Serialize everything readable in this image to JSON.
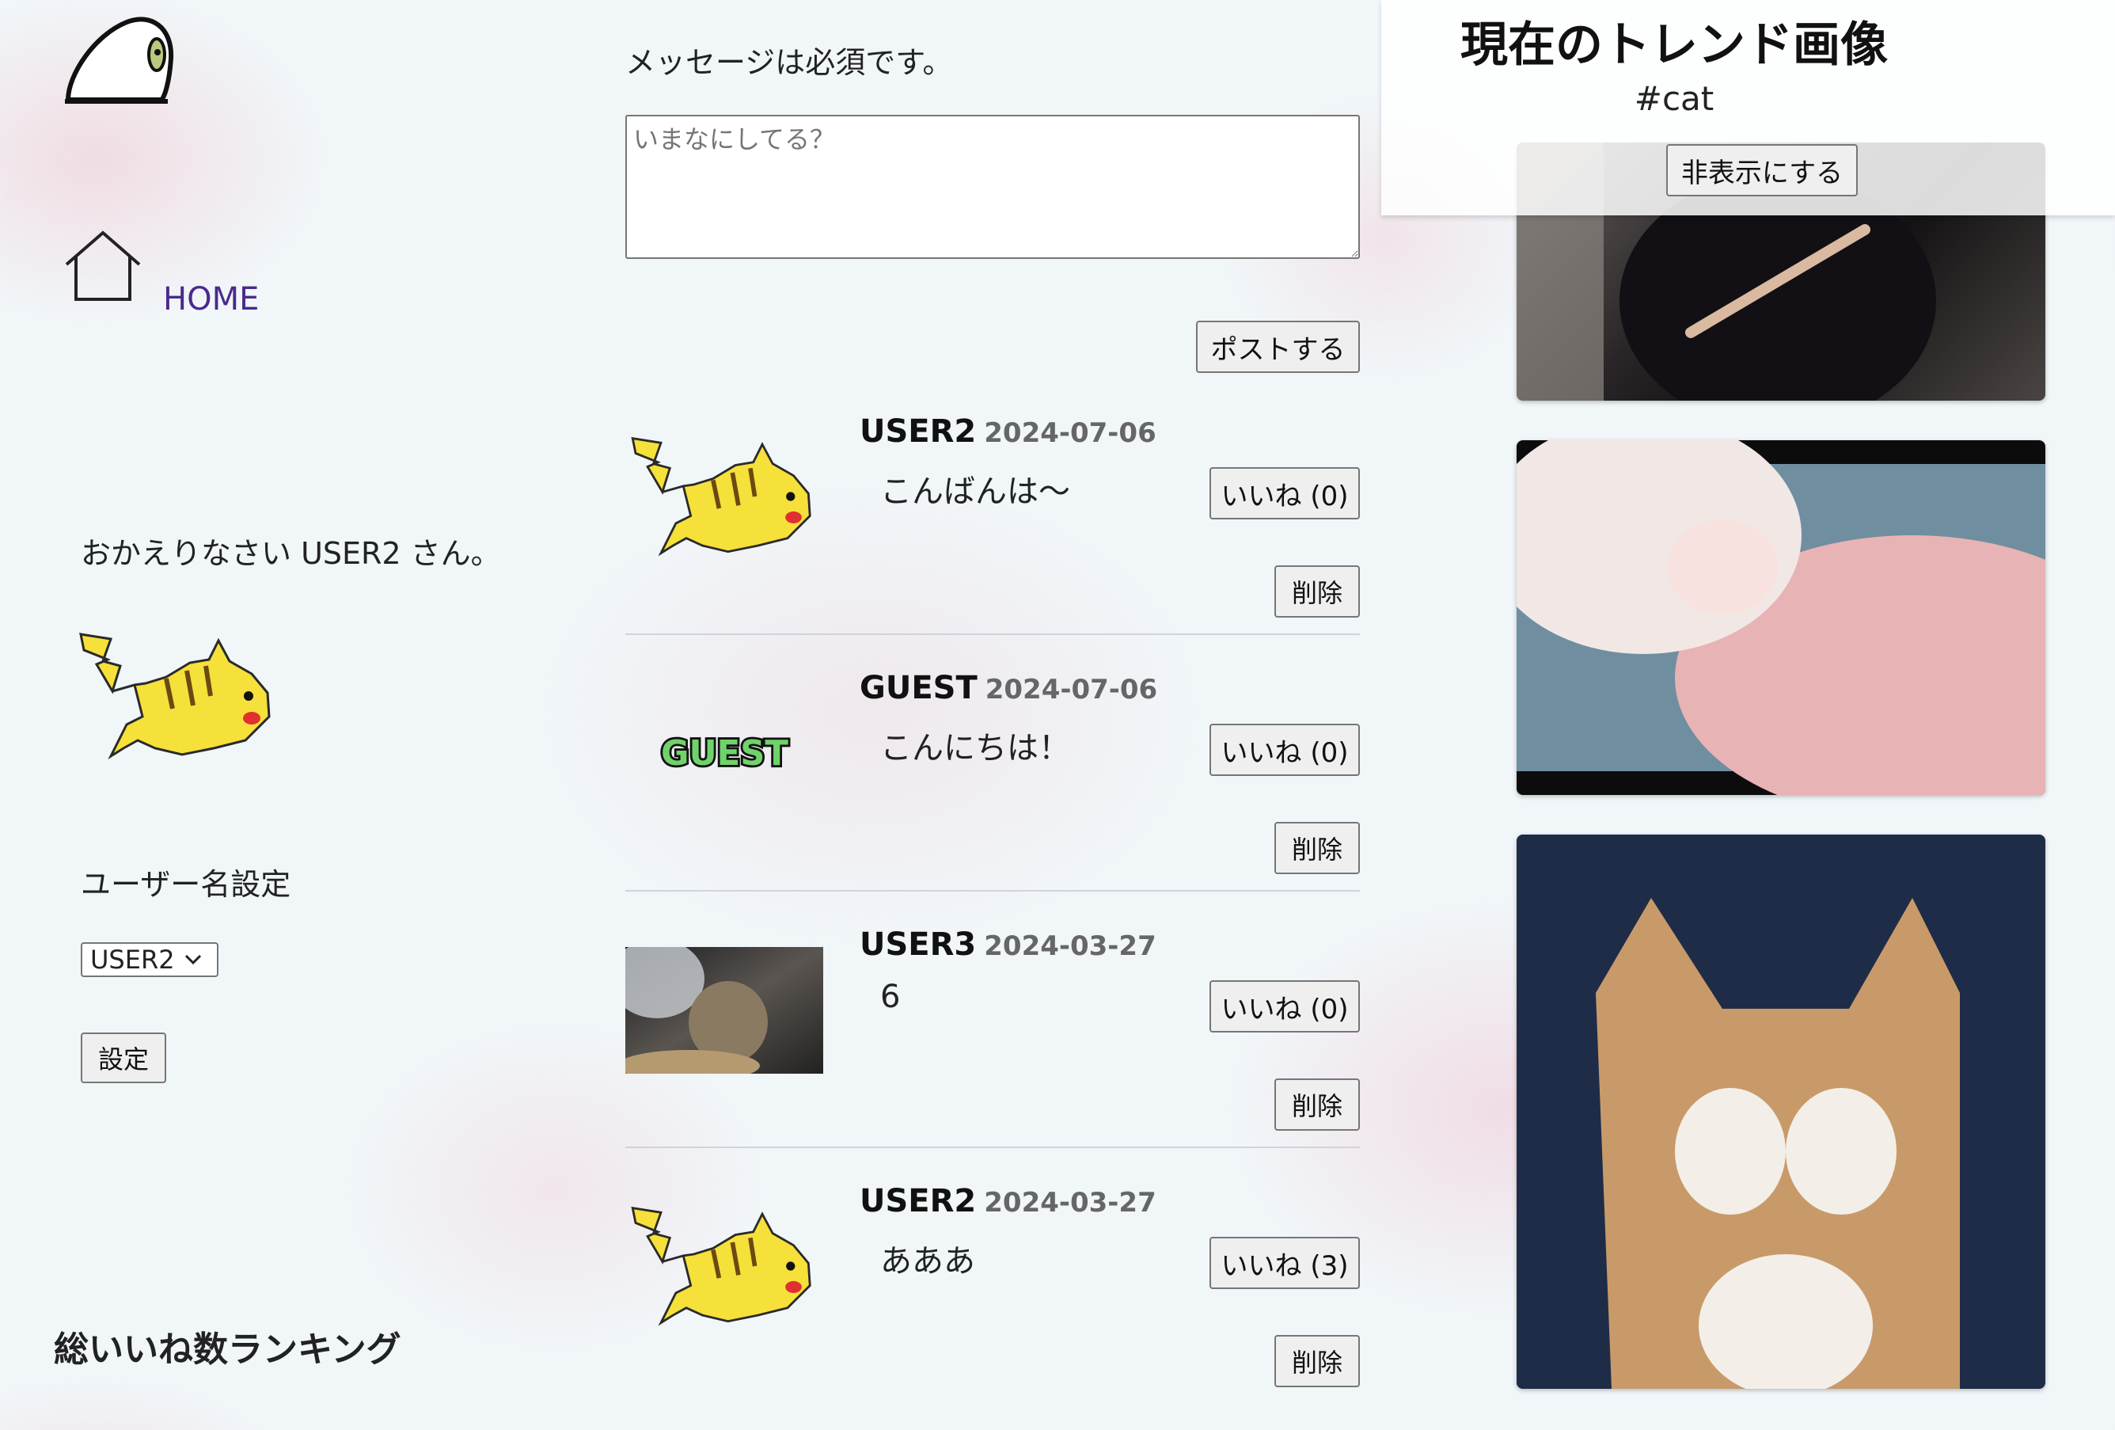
{
  "sidebar": {
    "logo_icon": "parrot-logo-icon",
    "home_icon": "home-icon",
    "home_label": "HOME",
    "welcome": "おかえりなさい USER2 さん。",
    "username_setting_label": "ユーザー名設定",
    "selected_user": "USER2",
    "set_button": "設定",
    "ranking_title": "総いいね数ランキング"
  },
  "composer": {
    "required_message": "メッセージは必須です。",
    "placeholder": "いまなにしてる？",
    "post_button": "ポストする"
  },
  "posts": [
    {
      "author": "USER2",
      "date": "2024-07-06",
      "body": "こんばんは〜",
      "like_label": "いいね (0)",
      "delete_label": "削除",
      "avatar": "pikachu-avatar"
    },
    {
      "author": "GUEST",
      "date": "2024-07-06",
      "body": "こんにちは！",
      "like_label": "いいね (0)",
      "delete_label": "削除",
      "avatar": "guest-avatar",
      "avatar_text": "GUEST"
    },
    {
      "author": "USER3",
      "date": "2024-03-27",
      "body": "6",
      "like_label": "いいね (0)",
      "delete_label": "削除",
      "avatar": "cat-photo-avatar"
    },
    {
      "author": "USER2",
      "date": "2024-03-27",
      "body": "あああ",
      "like_label": "いいね (3)",
      "delete_label": "削除",
      "avatar": "pikachu-avatar"
    }
  ],
  "trends": {
    "title": "現在のトレンド画像",
    "tag": "#cat",
    "hide_button": "非表示にする",
    "images": [
      "cat-gif-1",
      "cat-gif-2",
      "cat-gif-3"
    ]
  },
  "colors": {
    "home_link": "#4a2a8c",
    "background": "#f1f6f9",
    "pikachu_yellow": "#f6e03a"
  }
}
